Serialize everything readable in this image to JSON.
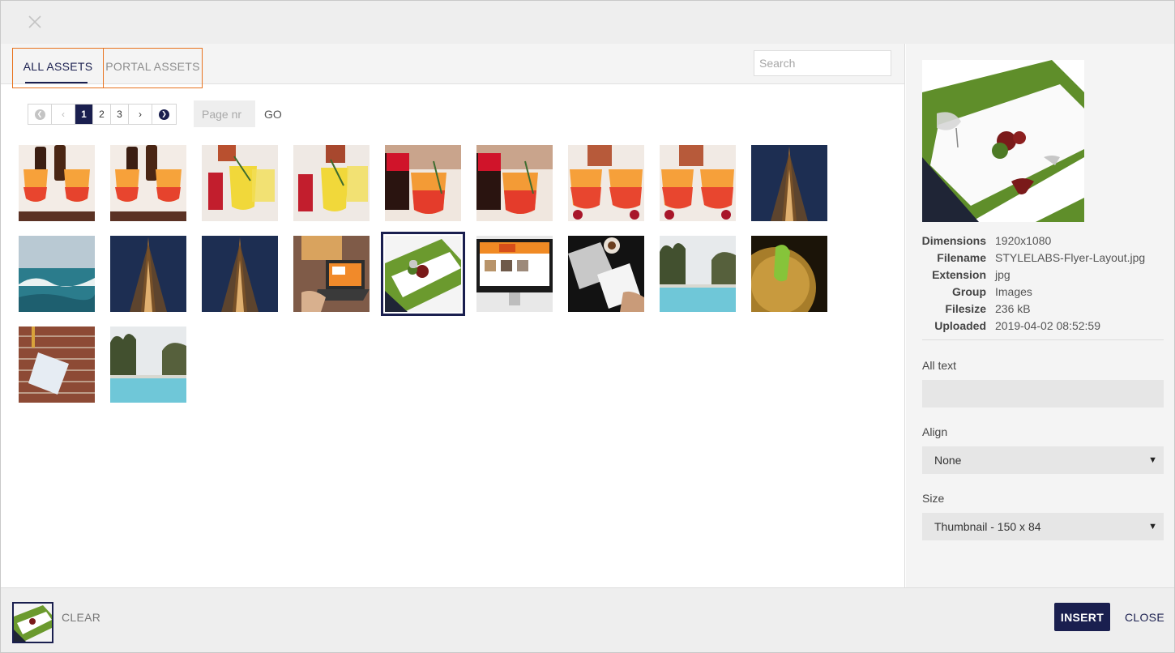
{
  "dialog": {
    "close_icon": "close-icon",
    "colors": {
      "accent": "#1a1f4f",
      "tab_highlight": "#e8731f",
      "panel": "#f4f4f4",
      "bar": "#eeeeee"
    }
  },
  "tabs": [
    {
      "label": "ALL ASSETS",
      "active": true
    },
    {
      "label": "PORTAL ASSETS",
      "active": false
    }
  ],
  "search": {
    "placeholder": "Search"
  },
  "pagination": {
    "first_icon": "first-page-icon",
    "prev_icon": "prev-page-icon",
    "pages": [
      "1",
      "2",
      "3"
    ],
    "current": "1",
    "next_icon": "next-page-icon",
    "last_icon": "last-page-icon",
    "page_input_placeholder": "Page nr",
    "go_label": "GO"
  },
  "assets": [
    {
      "subject": "orange cocktails with bottles"
    },
    {
      "subject": "orange cocktails with bottles"
    },
    {
      "subject": "yellow and red drinks"
    },
    {
      "subject": "yellow and red drinks"
    },
    {
      "subject": "red drink pour with rosemary"
    },
    {
      "subject": "red drink pour with rosemary"
    },
    {
      "subject": "orange cocktails with berries"
    },
    {
      "subject": "orange cocktails with berries"
    },
    {
      "subject": "eiffel tower at dusk"
    },
    {
      "subject": "ocean waves on rocks"
    },
    {
      "subject": "eiffel tower at dusk"
    },
    {
      "subject": "eiffel tower at dusk"
    },
    {
      "subject": "laptop on yellow desk"
    },
    {
      "subject": "STYLELABS flyer layout",
      "selected": true
    },
    {
      "subject": "orange website on monitor"
    },
    {
      "subject": "laptop and notes on dark desk"
    },
    {
      "subject": "infinity pool and trees"
    },
    {
      "subject": "lime in golden drink"
    },
    {
      "subject": "paper note on brick wall"
    },
    {
      "subject": "infinity pool and trees"
    }
  ],
  "details": {
    "rows": [
      {
        "label": "Dimensions",
        "value": "1920x1080"
      },
      {
        "label": "Filename",
        "value": "STYLELABS-Flyer-Layout.jpg"
      },
      {
        "label": "Extension",
        "value": "jpg"
      },
      {
        "label": "Group",
        "value": "Images"
      },
      {
        "label": "Filesize",
        "value": "236 kB"
      },
      {
        "label": "Uploaded",
        "value": "2019-04-02 08:52:59"
      }
    ],
    "alt_text_label": "All text",
    "alt_text_value": "",
    "align_label": "Align",
    "align_value": "None",
    "size_label": "Size",
    "size_value": "Thumbnail - 150 x 84"
  },
  "footer": {
    "clear_label": "CLEAR",
    "insert_label": "INSERT",
    "close_label": "CLOSE"
  }
}
